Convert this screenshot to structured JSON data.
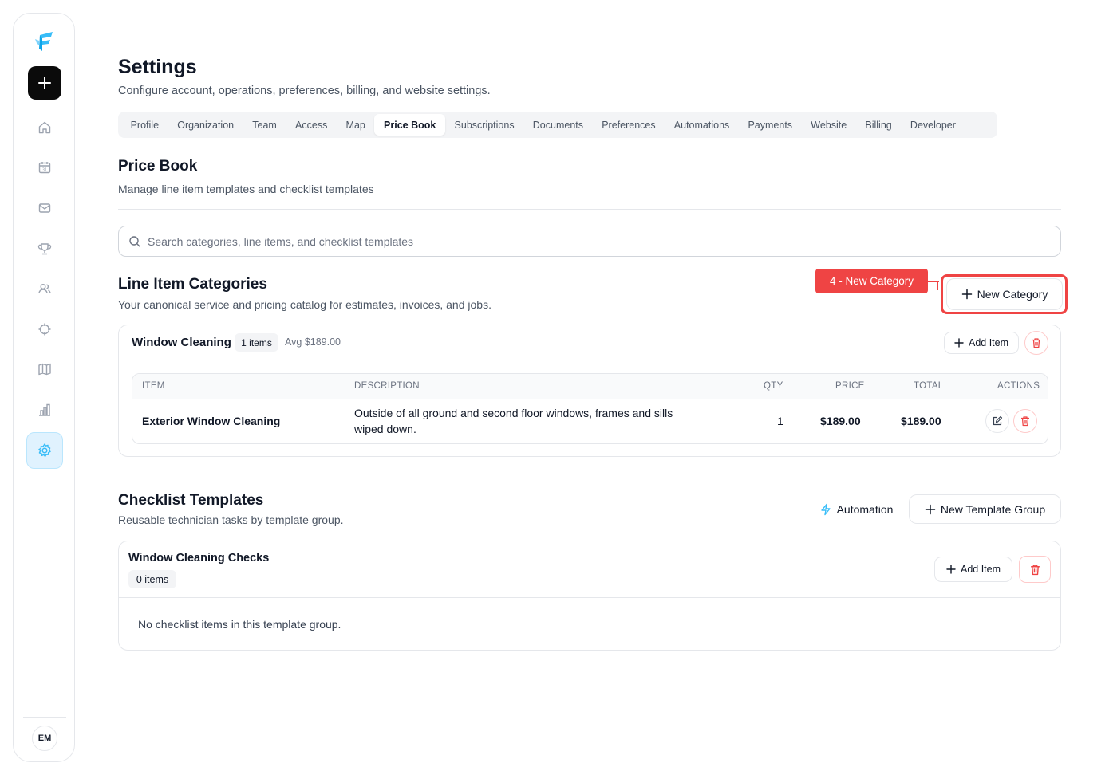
{
  "sidebar": {
    "avatar_initials": "EM",
    "items": [
      {
        "name": "home-icon"
      },
      {
        "name": "calendar-icon"
      },
      {
        "name": "mail-icon"
      },
      {
        "name": "trophy-icon"
      },
      {
        "name": "users-icon"
      },
      {
        "name": "crosshair-icon"
      },
      {
        "name": "map-icon"
      },
      {
        "name": "bar-chart-icon"
      },
      {
        "name": "gear-icon",
        "active": true
      }
    ]
  },
  "header": {
    "title": "Settings",
    "subtitle": "Configure account, operations, preferences, billing, and website settings."
  },
  "tabs": [
    "Profile",
    "Organization",
    "Team",
    "Access",
    "Map",
    "Price Book",
    "Subscriptions",
    "Documents",
    "Preferences",
    "Automations",
    "Payments",
    "Website",
    "Billing",
    "Developer"
  ],
  "active_tab": "Price Book",
  "price_book": {
    "title": "Price Book",
    "subtitle": "Manage line item templates and checklist templates"
  },
  "search": {
    "placeholder": "Search categories, line items, and checklist templates"
  },
  "line_items": {
    "title": "Line Item Categories",
    "subtitle": "Your canonical service and pricing catalog for estimates, invoices, and jobs.",
    "new_category_label": "New Category",
    "annotation": "4 - New Category",
    "category": {
      "name": "Window Cleaning",
      "count_badge": "1 items",
      "avg": "Avg $189.00",
      "add_item_label": "Add Item",
      "columns": [
        "ITEM",
        "DESCRIPTION",
        "QTY",
        "PRICE",
        "TOTAL",
        "ACTIONS"
      ],
      "rows": [
        {
          "item": "Exterior Window Cleaning",
          "description_line1": "Outside of all ground and second floor windows, frames and sills",
          "description_line2": "wiped down.",
          "qty": "1",
          "price": "$189.00",
          "total": "$189.00"
        }
      ]
    }
  },
  "checklists": {
    "title": "Checklist Templates",
    "subtitle": "Reusable technician tasks by template group.",
    "automation_label": "Automation",
    "new_group_label": "New Template Group",
    "group": {
      "name": "Window Cleaning Checks",
      "count_badge": "0 items",
      "add_item_label": "Add Item",
      "empty_text": "No checklist items in this template group."
    }
  },
  "colors": {
    "accent": "#38bdf8",
    "danger": "#ef4444",
    "text": "#111827",
    "muted": "#4b5563"
  }
}
